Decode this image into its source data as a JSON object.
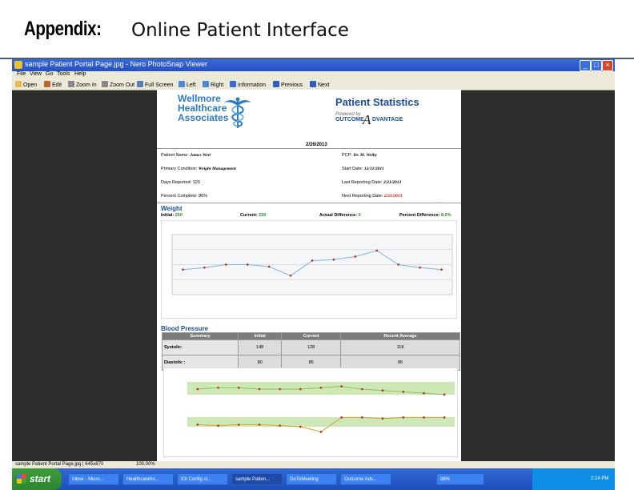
{
  "slide": {
    "title_bold": "Appendix:",
    "title_rest": "Online Patient Interface"
  },
  "window": {
    "title": "sample Patient Portal Page.jpg - Nero PhotoSnap Viewer",
    "menu": [
      "File",
      "View",
      "Go",
      "Tools",
      "Help"
    ],
    "toolbar": [
      "Open",
      "Edit",
      "Zoom In",
      "Zoom Out",
      "Full Screen",
      "Left",
      "Right",
      "Information",
      "Previous",
      "Next"
    ],
    "status_left": "sample Patient Portal Page.jpg | 645x870",
    "status_zoom": "100.00%"
  },
  "taskbar": {
    "start": "start",
    "tasks": [
      "Inbox - Micro...",
      "Healthcareho...",
      "IOI Config cl...",
      "sample Patien...",
      "GoToMeeting",
      "Outcome Adv...",
      "98%"
    ],
    "time": "2:24 PM"
  },
  "icons": {
    "start": "windows-flag-icon",
    "logo": "caduceus-icon"
  },
  "colors": {
    "brand_blue": "#1a4c9a",
    "logo_blue": "#2b7cc4",
    "accent_red": "#dd0000",
    "good_green": "#2a8a2a"
  },
  "portal": {
    "org_name": [
      "Wellmore",
      "Healthcare",
      "Associates"
    ],
    "heading": "Patient Statistics",
    "partner": {
      "powered_by": "Powered by",
      "name_left": "OUTCOME",
      "name_mark": "A",
      "name_right": "DVANTAGE"
    },
    "date": "2/26/2013",
    "fields": {
      "patient_name_label": "Patient Name:",
      "patient_name": "James Weir",
      "pcp_label": "PCP:",
      "pcp": "Dr. M. Welby",
      "condition_label": "Primary Condition:",
      "condition": "Weight Management",
      "start_label": "Start Date:",
      "start": "12/31/2011",
      "days_label": "Days Reported:",
      "days": "120",
      "last_label": "Last Reporting Date:",
      "last": "2/21/2013",
      "percent_label": "Percent Complete:",
      "percent": "86%",
      "next_label": "Next Reporting Date:",
      "next": "2/21/2013"
    },
    "weight": {
      "heading": "Weight",
      "initial_label": "Initial:",
      "initial": "250",
      "current_label": "Current:",
      "current": "230",
      "actual_label": "Actual Difference:",
      "actual": "0",
      "pdiff_label": "Percent Difference:",
      "pdiff": "8.0%"
    },
    "bp": {
      "heading": "Blood Pressure",
      "columns": [
        "Summary",
        "Initial",
        "Current",
        "Recent Average"
      ],
      "systolic_label": "Systolic:",
      "systolic": [
        "148",
        "128",
        "118"
      ],
      "diastolic_label": "Diastolic :",
      "diastolic": [
        "80",
        "85",
        "86"
      ]
    }
  },
  "chart_data": [
    {
      "type": "line",
      "values": [
        225,
        227,
        230,
        230,
        228,
        219,
        234,
        235,
        238,
        244,
        230,
        227,
        225
      ],
      "ylim": [
        200,
        260
      ],
      "grid": true
    },
    {
      "type": "line",
      "series": [
        {
          "values": [
            150,
            151,
            151,
            150,
            150,
            150,
            151,
            152,
            150,
            149,
            148,
            147,
            146
          ]
        },
        {
          "values": [
            83,
            82,
            83,
            83,
            82,
            81,
            76,
            90,
            90,
            89,
            90,
            90,
            90
          ]
        }
      ],
      "grid": true
    }
  ]
}
